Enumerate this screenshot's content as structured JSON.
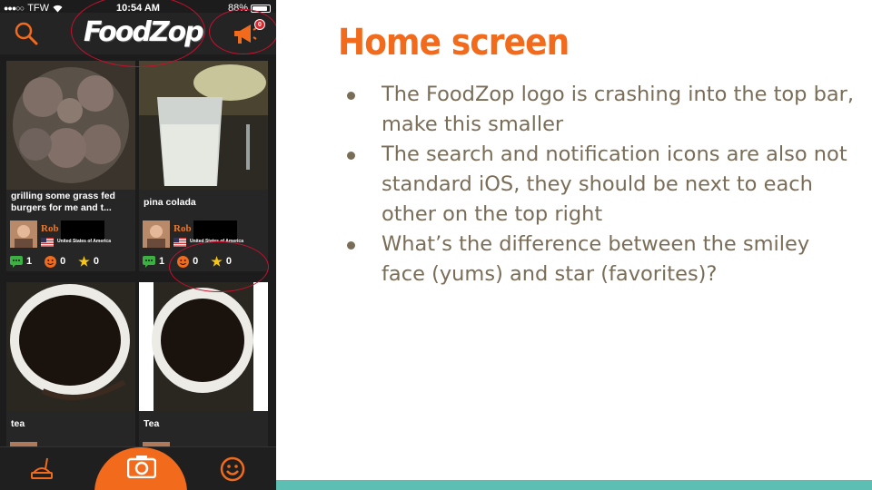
{
  "status_bar": {
    "carrier": "TFW",
    "time": "10:54 AM",
    "battery": "88%",
    "battery_level": 0.88
  },
  "nav": {
    "logo": "FoodZop",
    "notification_count": "0"
  },
  "feed": {
    "posts": [
      {
        "title": "grilling some grass fed burgers for me and t...",
        "user": "Rob",
        "country": "United States of America",
        "comments": "1",
        "yums": "0",
        "favorites": "0",
        "photo": "burgers-in-pan"
      },
      {
        "title": "pina colada",
        "user": "Rob",
        "country": "United States of America",
        "comments": "1",
        "yums": "0",
        "favorites": "0",
        "photo": "pina-colada-glass"
      },
      {
        "title": "tea",
        "photo": "tea-cup"
      },
      {
        "title": "Tea",
        "photo": "tea-cup"
      }
    ]
  },
  "tabbar": {
    "tabs": [
      {
        "icon": "food-icon"
      },
      {
        "icon": "camera-icon"
      },
      {
        "icon": "smiley-icon"
      }
    ]
  },
  "slide": {
    "title": "Home screen",
    "bullets": [
      "The FoodZop logo is crashing into the top bar, make this smaller",
      "The search and notification icons are also not standard iOS, they should be next to each other on the top right",
      "What’s the difference between the smiley face (yums) and star (favorites)?"
    ]
  },
  "colors": {
    "accent": "#f26a1b",
    "annotation": "#c8102e",
    "body_text": "#7a6d58",
    "footer_bar": "#5dbfb4"
  }
}
